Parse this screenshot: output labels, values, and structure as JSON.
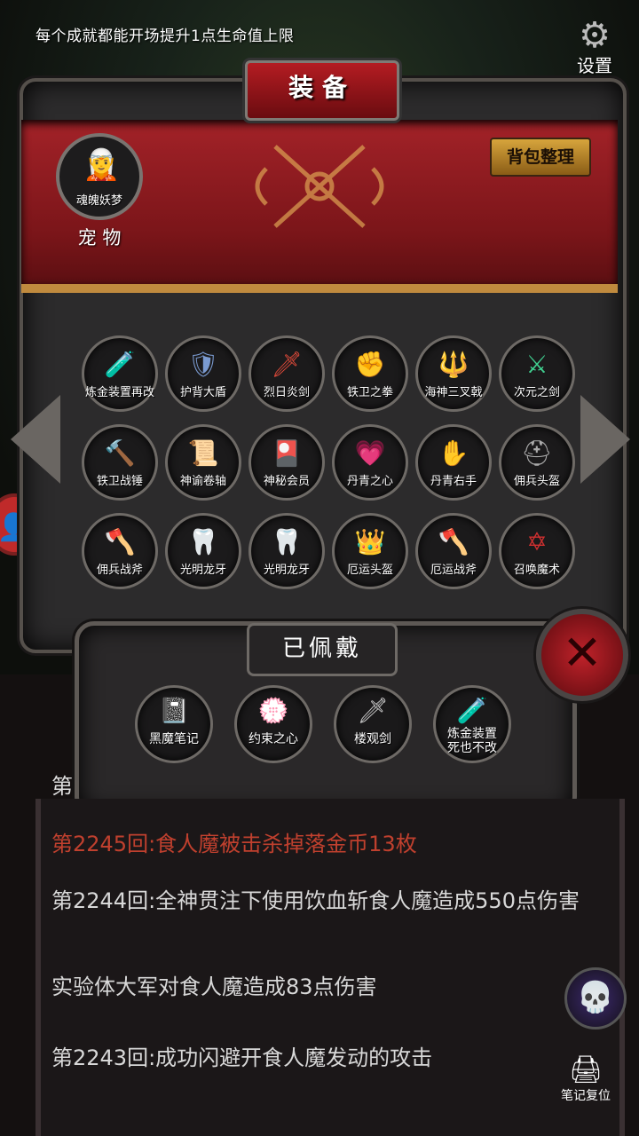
{
  "top_tip": "每个成就都能开场提升1点生命值上限",
  "settings_label": "设置",
  "panel_title": "装备",
  "pet": {
    "name": "魂魄妖梦",
    "label": "宠 物"
  },
  "sort_button": "背包整理",
  "inventory": [
    {
      "name": "炼金装置再改",
      "icon": "🧪",
      "color": "#e8a040"
    },
    {
      "name": "护背大盾",
      "icon": "🛡",
      "color": "#7a9ad0"
    },
    {
      "name": "烈日炎剑",
      "icon": "🗡",
      "color": "#e04a3a"
    },
    {
      "name": "铁卫之拳",
      "icon": "✊",
      "color": "#aaaaaa"
    },
    {
      "name": "海神三叉戟",
      "icon": "🔱",
      "color": "#e0c040"
    },
    {
      "name": "次元之剑",
      "icon": "⚔",
      "color": "#40d090"
    },
    {
      "name": "铁卫战锤",
      "icon": "🔨",
      "color": "#bbbbbb"
    },
    {
      "name": "神谕卷轴",
      "icon": "📜",
      "color": "#e8c070"
    },
    {
      "name": "神秘会员",
      "icon": "🎴",
      "color": "#d04030"
    },
    {
      "name": "丹青之心",
      "icon": "💗",
      "color": "#c05050"
    },
    {
      "name": "丹青右手",
      "icon": "✋",
      "color": "#e0e0e0"
    },
    {
      "name": "佣兵头盔",
      "icon": "⛑",
      "color": "#aaaaaa"
    },
    {
      "name": "佣兵战斧",
      "icon": "🪓",
      "color": "#cccccc"
    },
    {
      "name": "光明龙牙",
      "icon": "🦷",
      "color": "#f0e0a0"
    },
    {
      "name": "光明龙牙",
      "icon": "🦷",
      "color": "#f0e0a0"
    },
    {
      "name": "厄运头盔",
      "icon": "👑",
      "color": "#d03030"
    },
    {
      "name": "厄运战斧",
      "icon": "🪓",
      "color": "#d04030"
    },
    {
      "name": "召唤魔术",
      "icon": "✡",
      "color": "#d03030"
    }
  ],
  "equipped_title": "已佩戴",
  "equipped": [
    {
      "name": "黑魔笔记",
      "icon": "📓",
      "color": "#bbbbbb"
    },
    {
      "name": "约束之心",
      "icon": "💮",
      "color": "#e04070"
    },
    {
      "name": "楼观剑",
      "icon": "🗡",
      "color": "#cccccc"
    },
    {
      "name": "炼金装置\n死也不改",
      "icon": "🧪",
      "color": "#e8a040"
    }
  ],
  "log_cut": "第",
  "log": [
    "第2245回:食人魔被击杀掉落金币13枚",
    "第2244回:全神贯注下使用饮血斩食人魔造成550点伤害",
    "实验体大军对食人魔造成83点伤害",
    "第2243回:成功闪避开食人魔发动的攻击"
  ],
  "notes_reset_label": "笔记复位",
  "close_icon": "✕"
}
